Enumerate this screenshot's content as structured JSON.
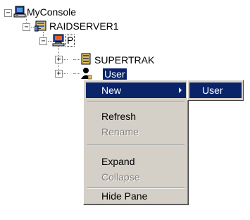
{
  "tree": {
    "root_label": "MyConsole",
    "server_label": "RAIDSERVER1",
    "p_label": "P",
    "supertrak_label": "SUPERTRAK",
    "selected_label": "User"
  },
  "context_menu": {
    "new_label": "New",
    "refresh_label": "Refresh",
    "rename_label": "Rename",
    "expand_label": "Expand",
    "collapse_label": "Collapse",
    "hide_pane_label": "Hide Pane"
  },
  "submenu": {
    "user_label": "User"
  },
  "colors": {
    "selection": "#0a246a",
    "menu_face": "#d4d0c8",
    "disabled_text": "#808080"
  }
}
